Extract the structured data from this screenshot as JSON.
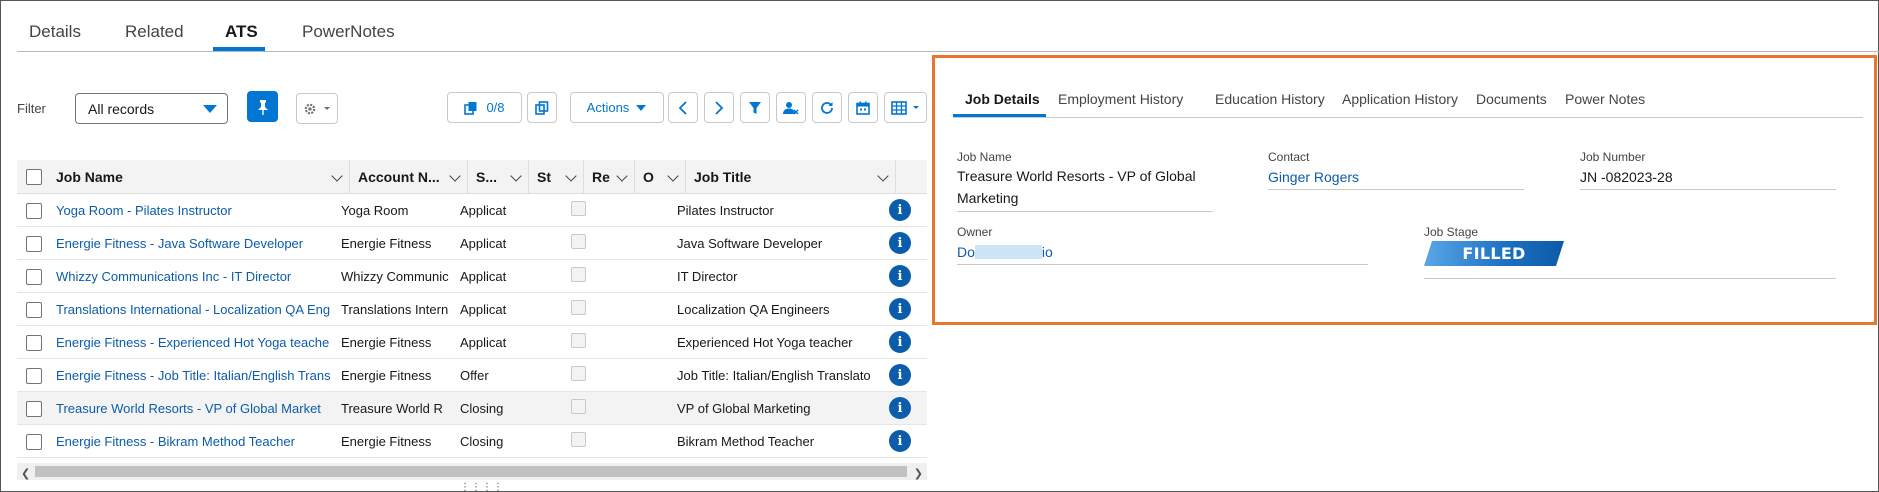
{
  "tabs": [
    {
      "label": "Details"
    },
    {
      "label": "Related"
    },
    {
      "label": "ATS"
    },
    {
      "label": "PowerNotes"
    }
  ],
  "toolbar": {
    "filter_label": "Filter",
    "filter_value": "All records",
    "selected_count": "0/8",
    "actions_label": "Actions"
  },
  "table": {
    "columns": [
      "Job Name",
      "Account N...",
      "S...",
      "St",
      "Re",
      "O",
      "Job Title"
    ],
    "rows": [
      {
        "job_name": "Yoga Room - Pilates Instructor",
        "account": "Yoga Room",
        "stage": "Applicat",
        "job_title": "Pilates Instructor"
      },
      {
        "job_name": "Energie Fitness - Java Software Developer",
        "account": "Energie Fitness",
        "stage": "Applicat",
        "job_title": "Java Software Developer"
      },
      {
        "job_name": "Whizzy Communications Inc - IT Director",
        "account": "Whizzy Communic",
        "stage": "Applicat",
        "job_title": "IT Director"
      },
      {
        "job_name": "Translations International - Localization QA Eng",
        "account": "Translations Intern",
        "stage": "Applicat",
        "job_title": "Localization QA Engineers"
      },
      {
        "job_name": "Energie Fitness - Experienced Hot Yoga teache",
        "account": "Energie Fitness",
        "stage": "Applicat",
        "job_title": "Experienced Hot Yoga teacher"
      },
      {
        "job_name": "Energie Fitness - Job Title: Italian/English Trans",
        "account": "Energie Fitness",
        "stage": "Offer",
        "job_title": "Job Title: Italian/English Translato"
      },
      {
        "job_name": "Treasure World Resorts - VP of Global Market",
        "account": "Treasure World R",
        "stage": "Closing",
        "job_title": "VP of Global Marketing"
      },
      {
        "job_name": "Energie Fitness - Bikram Method Teacher",
        "account": "Energie Fitness",
        "stage": "Closing",
        "job_title": "Bikram Method Teacher"
      }
    ]
  },
  "details": {
    "tabs": [
      "Job Details",
      "Employment History",
      "Education History",
      "Application History",
      "Documents",
      "Power Notes"
    ],
    "job_name_label": "Job Name",
    "job_name_line1": "Treasure World Resorts - VP of Global",
    "job_name_line2": "Marketing",
    "contact_label": "Contact",
    "contact_value": "Ginger Rogers",
    "job_number_label": "Job Number",
    "job_number_value": "JN -082023-28",
    "owner_label": "Owner",
    "owner_value_start": "Do",
    "owner_value_end": "io",
    "job_stage_label": "Job Stage",
    "job_stage_value": "FILLED"
  },
  "colors": {
    "brand": "#0176d3",
    "link": "#0b5cab",
    "highlight_border": "#e8772e"
  }
}
